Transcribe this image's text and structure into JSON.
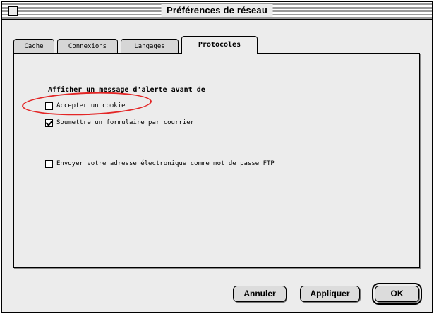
{
  "window": {
    "title": "Préférences de réseau"
  },
  "tabs": [
    {
      "label": "Cache",
      "active": false
    },
    {
      "label": "Connexions",
      "active": false
    },
    {
      "label": "Langages",
      "active": false
    },
    {
      "label": "Protocoles",
      "active": true
    }
  ],
  "alert_group": {
    "title": "Afficher un message d'alerte avant de",
    "options": [
      {
        "label": "Accepter un cookie",
        "checked": false
      },
      {
        "label": "Soumettre un formulaire par courrier",
        "checked": true
      }
    ]
  },
  "ftp_option": {
    "label": "Envoyer votre adresse électronique comme mot de passe FTP",
    "checked": false
  },
  "buttons": {
    "cancel": "Annuler",
    "apply": "Appliquer",
    "ok": "OK"
  },
  "annotation": {
    "highlight_color": "#e32626"
  }
}
